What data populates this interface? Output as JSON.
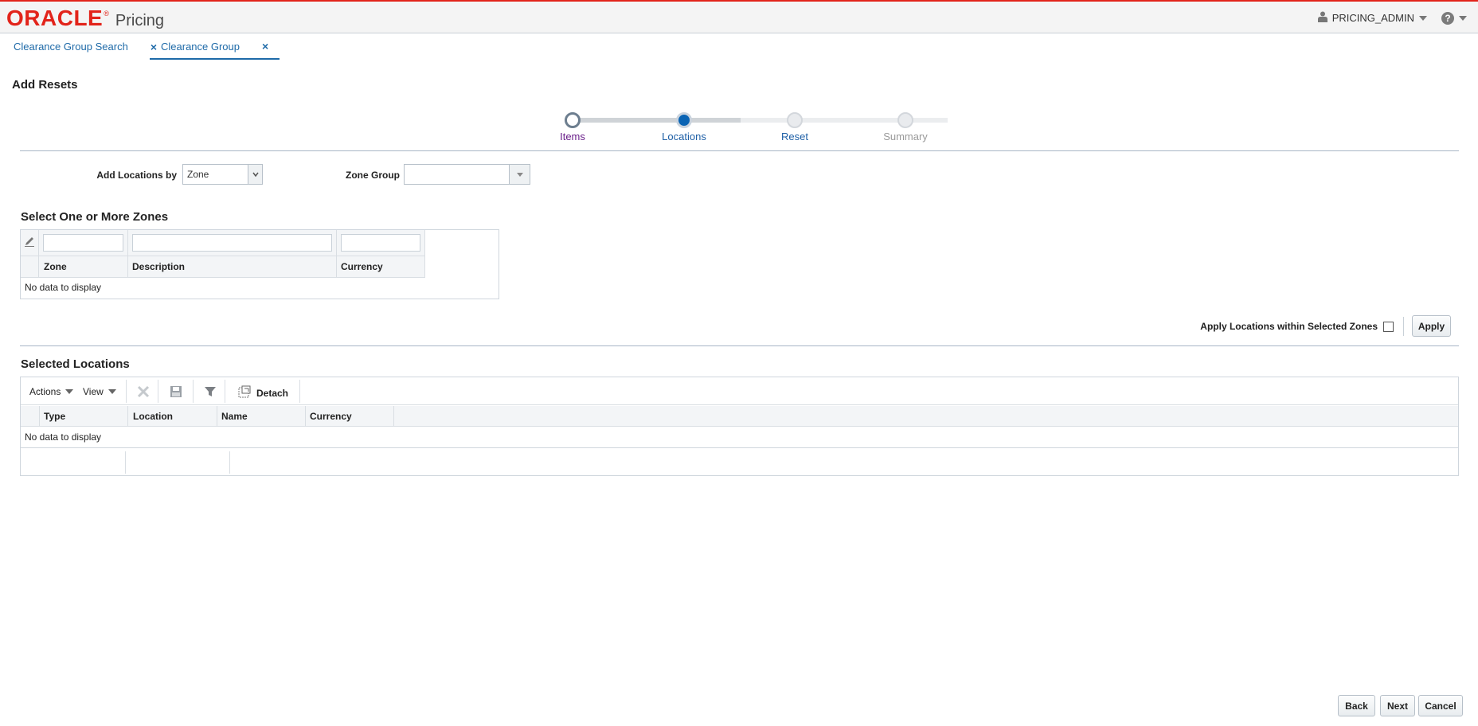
{
  "app": {
    "logo_text": "ORACLE",
    "app_name": "Pricing",
    "user": "PRICING_ADMIN"
  },
  "tabs": [
    {
      "label": "Clearance Group Search",
      "active": false
    },
    {
      "label": "Clearance Group",
      "active": true
    }
  ],
  "page": {
    "title": "Add Resets"
  },
  "train": {
    "stops": [
      {
        "label": "Items",
        "state": "visited",
        "color": "#6a1f8a"
      },
      {
        "label": "Locations",
        "state": "current",
        "color": "#1e5fa6"
      },
      {
        "label": "Reset",
        "state": "future",
        "color": "#1e5fa6"
      },
      {
        "label": "Summary",
        "state": "disabled",
        "color": "#9a9a9a"
      }
    ]
  },
  "form": {
    "add_locations_by_label": "Add Locations by",
    "add_locations_by_value": "Zone",
    "zone_group_label": "Zone Group",
    "zone_group_value": ""
  },
  "zones": {
    "title": "Select One or More Zones",
    "columns": [
      "Zone",
      "Description",
      "Currency"
    ],
    "empty_text": "No data to display"
  },
  "apply": {
    "checkbox_label": "Apply Locations within Selected Zones",
    "checked": false,
    "button_label": "Apply"
  },
  "selected_locations": {
    "title": "Selected Locations",
    "toolbar": {
      "actions_label": "Actions",
      "view_label": "View",
      "detach_label": "Detach"
    },
    "columns": [
      "Type",
      "Location",
      "Name",
      "Currency"
    ],
    "empty_text": "No data to display"
  },
  "footer": {
    "back_label": "Back",
    "next_label": "Next",
    "cancel_label": "Cancel"
  },
  "colors": {
    "brand_red": "#e2231a",
    "link_blue": "#1e6aa8",
    "current_stop": "#0a64b4"
  }
}
